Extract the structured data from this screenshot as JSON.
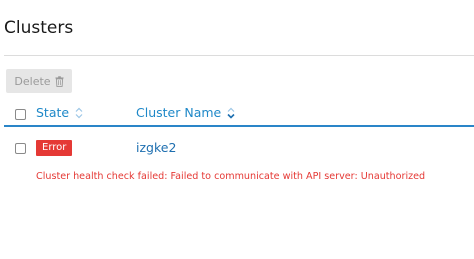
{
  "page": {
    "title": "Clusters"
  },
  "toolbar": {
    "delete_label": "Delete",
    "delete_icon": "trash-icon"
  },
  "table": {
    "columns": [
      {
        "label": "State",
        "sort_icon": "sort-both-icon"
      },
      {
        "label": "Cluster Name",
        "sort_icon": "sort-down-icon"
      }
    ],
    "rows": [
      {
        "state": "Error",
        "cluster_name": "izgke2",
        "message": "Cluster health check failed: Failed to communicate with API server: Unauthorized"
      }
    ]
  },
  "colors": {
    "accent": "#2a85c8",
    "link": "#1e6fb0",
    "error": "#e53935",
    "disabled_button": "#e6e6e6"
  }
}
